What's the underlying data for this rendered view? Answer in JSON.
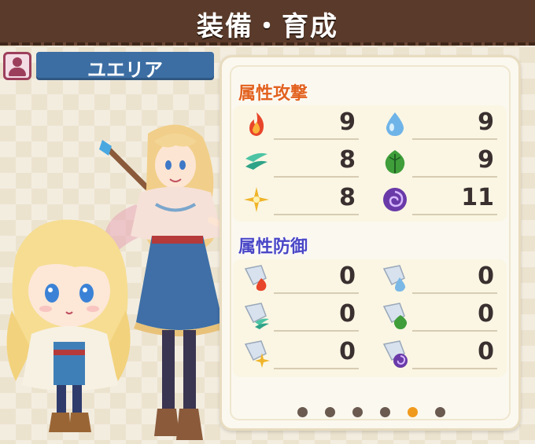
{
  "header": {
    "title": "装備・育成"
  },
  "character": {
    "name": "ユエリア"
  },
  "attack": {
    "title": "属性攻撃",
    "stats": [
      {
        "element": "fire",
        "icon": "fire-icon",
        "value": "9"
      },
      {
        "element": "water",
        "icon": "water-drop-icon",
        "value": "9"
      },
      {
        "element": "wind",
        "icon": "wind-icon",
        "value": "8"
      },
      {
        "element": "earth",
        "icon": "leaf-icon",
        "value": "9"
      },
      {
        "element": "light",
        "icon": "light-star-icon",
        "value": "8"
      },
      {
        "element": "dark",
        "icon": "dark-swirl-icon",
        "value": "11"
      }
    ]
  },
  "defense": {
    "title": "属性防御",
    "stats": [
      {
        "element": "fire",
        "icon": "fire-shield-icon",
        "value": "0"
      },
      {
        "element": "water",
        "icon": "water-shield-icon",
        "value": "0"
      },
      {
        "element": "wind",
        "icon": "wind-shield-icon",
        "value": "0"
      },
      {
        "element": "earth",
        "icon": "leaf-shield-icon",
        "value": "0"
      },
      {
        "element": "light",
        "icon": "light-shield-icon",
        "value": "0"
      },
      {
        "element": "dark",
        "icon": "dark-shield-icon",
        "value": "0"
      }
    ]
  },
  "pager": {
    "total": 6,
    "active": 5
  },
  "colors": {
    "header": "#5a3a2a",
    "name_plate": "#3c6ea3",
    "attack_title": "#e2621f",
    "defense_title": "#4a47c7",
    "pager_active": "#f09a1d",
    "pager_inactive": "#6a5a4f"
  }
}
